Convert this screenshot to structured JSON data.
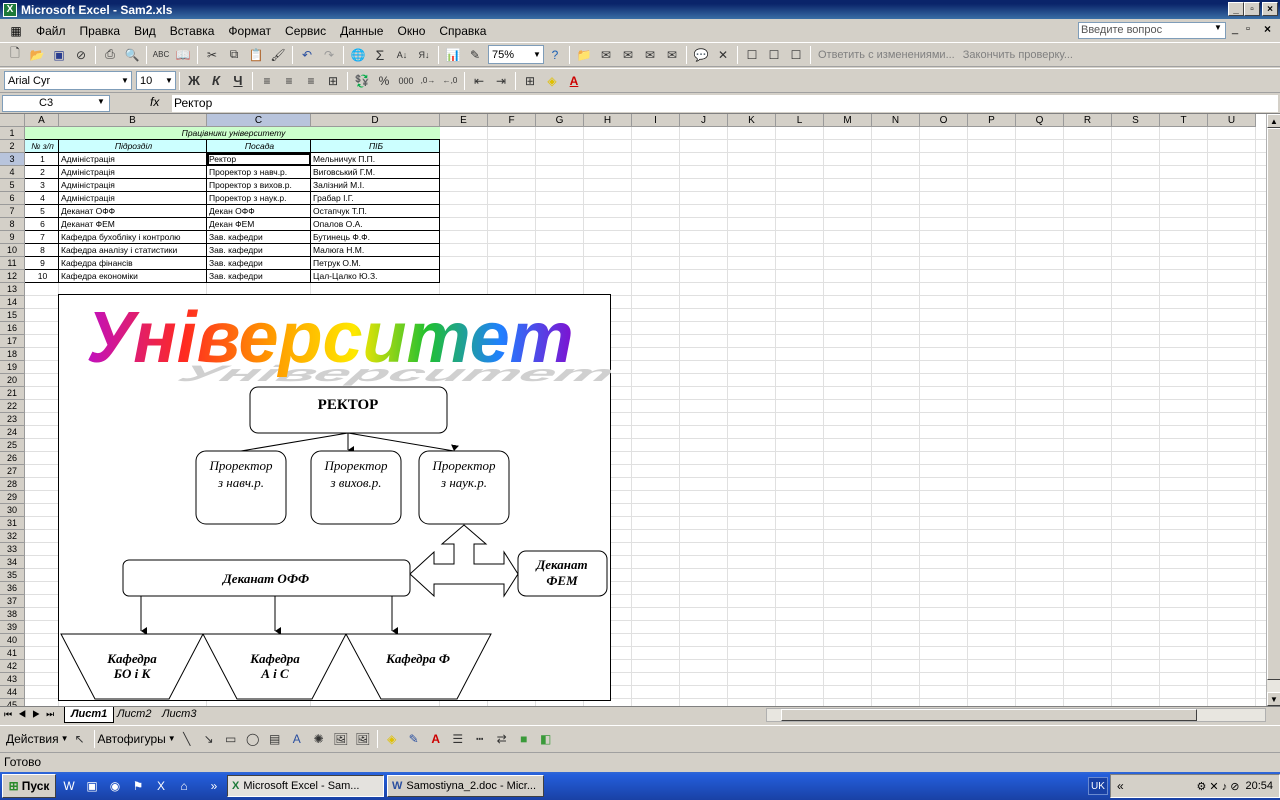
{
  "window": {
    "title": "Microsoft Excel - Sam2.xls",
    "min": "_",
    "max": "▫",
    "close": "×"
  },
  "menu": [
    "Файл",
    "Правка",
    "Вид",
    "Вставка",
    "Формат",
    "Сервис",
    "Данные",
    "Окно",
    "Справка"
  ],
  "help_box": {
    "placeholder": "Введите вопрос"
  },
  "toolbar": {
    "zoom": "75%",
    "font": "Arial Cyr",
    "size": "10",
    "bold": "Ж",
    "italic": "К",
    "underline": "Ч",
    "review_reply": "Ответить с изменениями...",
    "review_end": "Закончить проверку..."
  },
  "formula_bar": {
    "name_box": "C3",
    "fx": "fx",
    "value": "Ректор"
  },
  "columns": [
    "A",
    "B",
    "C",
    "D",
    "E",
    "F",
    "G",
    "H",
    "I",
    "J",
    "K",
    "L",
    "M",
    "N",
    "O",
    "P",
    "Q",
    "R",
    "S",
    "T",
    "U"
  ],
  "rows": [
    "1",
    "2",
    "3",
    "4",
    "5",
    "6",
    "7",
    "8",
    "9",
    "10",
    "11",
    "12",
    "13",
    "14",
    "15",
    "16",
    "17",
    "18",
    "19",
    "20",
    "21",
    "22",
    "23",
    "24",
    "25",
    "26",
    "27",
    "28",
    "29",
    "30",
    "31",
    "32",
    "33",
    "34",
    "35",
    "36",
    "37",
    "38",
    "39",
    "40",
    "41",
    "42",
    "43",
    "44",
    "45"
  ],
  "table": {
    "title": "Працівники університету",
    "headers": [
      "№ з/п",
      "Підрозділ",
      "Посада",
      "ПІБ"
    ],
    "rows": [
      [
        "1",
        "Адміністрація",
        "Ректор",
        "Мельничук П.П."
      ],
      [
        "2",
        "Адміністрація",
        "Проректор з навч.р.",
        "Виговський Г.М."
      ],
      [
        "3",
        "Адміністрація",
        "Проректор з вихов.р.",
        "Залізний М.І."
      ],
      [
        "4",
        "Адміністрація",
        "Проректор з наук.р.",
        "Грабар І.Г."
      ],
      [
        "5",
        "Деканат ОФФ",
        "Декан ОФФ",
        "Остапчук Т.П."
      ],
      [
        "6",
        "Деканат ФЕМ",
        "Декан ФЕМ",
        "Опалов О.А."
      ],
      [
        "7",
        "Кафедра бухобліку і контролю",
        "Зав. кафедри",
        "Бутинець Ф.Ф."
      ],
      [
        "8",
        "Кафедра аналізу і статистики",
        "Зав. кафедри",
        "Малюга Н.М."
      ],
      [
        "9",
        "Кафедра фінансів",
        "Зав. кафедри",
        "Петрук О.М."
      ],
      [
        "10",
        "Кафедра економіки",
        "Зав. кафедри",
        "Цал-Цалко Ю.З."
      ]
    ]
  },
  "diagram": {
    "wordart": "Університет",
    "rector": "РЕКТОР",
    "prorector1": [
      "Проректор",
      "з навч.р."
    ],
    "prorector2": [
      "Проректор",
      "з вихов.р."
    ],
    "prorector3": [
      "Проректор",
      "з наук.р."
    ],
    "dekanat_off": "Деканат ОФФ",
    "dekanat_fem": [
      "Деканат",
      "ФЕМ"
    ],
    "kafedra1": [
      "Кафедра",
      "БО і К"
    ],
    "kafedra2": [
      "Кафедра",
      "А і С"
    ],
    "kafedra3": "Кафедра Ф"
  },
  "sheets": [
    "Лист1",
    "Лист2",
    "Лист3"
  ],
  "drawing": {
    "actions": "Действия",
    "autoshapes": "Автофигуры"
  },
  "status": "Готово",
  "taskbar": {
    "start": "Пуск",
    "task1": "Microsoft Excel - Sam...",
    "task2": "Samostiyna_2.doc - Micr...",
    "lang": "UK",
    "clock": "20:54"
  }
}
